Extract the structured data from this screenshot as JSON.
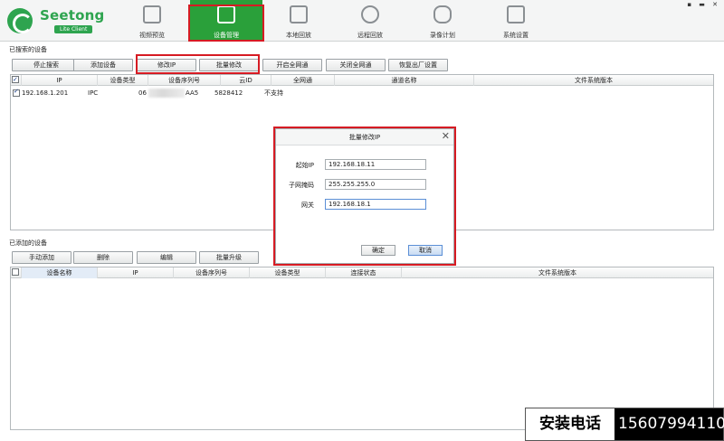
{
  "app": {
    "logo_text": "Seetong",
    "logo_badge": "Lite Client",
    "window_controls": "▪ ▬ ✕"
  },
  "nav": [
    {
      "label": "视频预览",
      "icon": "video-preview-icon"
    },
    {
      "label": "设备管理",
      "icon": "device-manage-icon",
      "active": true
    },
    {
      "label": "本地回放",
      "icon": "local-playback-icon"
    },
    {
      "label": "远程回放",
      "icon": "remote-playback-icon"
    },
    {
      "label": "录像计划",
      "icon": "record-plan-icon"
    },
    {
      "label": "系统设置",
      "icon": "system-settings-icon"
    }
  ],
  "searched": {
    "section_label": "已搜索的设备",
    "buttons": [
      "停止搜索",
      "添加设备",
      "修改IP",
      "批量修改",
      "开启全网通",
      "关闭全网通",
      "恢复出厂设置"
    ],
    "columns": [
      "IP",
      "设备类型",
      "设备序列号",
      "云ID",
      "全网通",
      "通道名称",
      "文件系统版本"
    ],
    "rows": [
      {
        "checked": true,
        "ip": "192.168.1.201",
        "type": "IPC",
        "serial_prefix": "06",
        "serial_suffix": "AA5",
        "cloud_id": "5828412",
        "all_network": "不支持",
        "channel": "",
        "fs_version": ""
      }
    ]
  },
  "added": {
    "section_label": "已添加的设备",
    "buttons": [
      "手动添加",
      "删除",
      "编辑",
      "批量升级"
    ],
    "columns": [
      "设备名称",
      "IP",
      "设备序列号",
      "设备类型",
      "连接状态",
      "文件系统版本"
    ]
  },
  "dialog": {
    "title": "批量修改IP",
    "close": "✕",
    "fields": [
      {
        "label": "起始IP",
        "value": "192.168.18.11"
      },
      {
        "label": "子网掩码",
        "value": "255.255.255.0"
      },
      {
        "label": "网关",
        "value": "192.168.18.1"
      }
    ],
    "ok": "确定",
    "cancel": "取消"
  },
  "banner": {
    "label": "安装电话",
    "number": "15607994110"
  },
  "colors": {
    "brand_green": "#2ea44f",
    "nav_active": "#2aa03a",
    "highlight_red": "#d61b23"
  }
}
